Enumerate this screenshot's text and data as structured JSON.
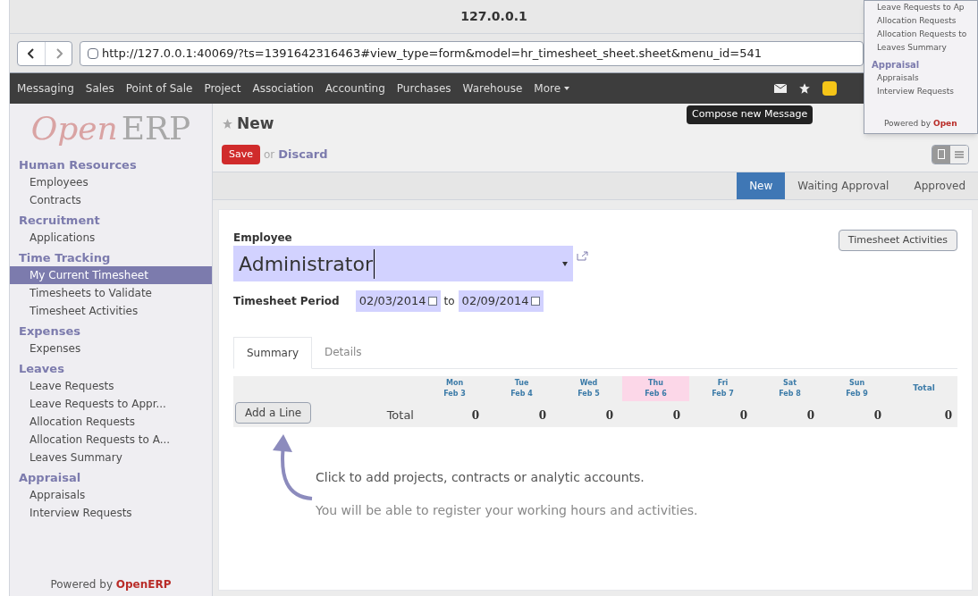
{
  "window": {
    "title": "127.0.0.1"
  },
  "address_bar": {
    "url": "http://127.0.0.1:40069/?ts=1391642316463#view_type=form&model=hr_timesheet_sheet.sheet&menu_id=541"
  },
  "top_menu": [
    "Messaging",
    "Sales",
    "Point of Sale",
    "Project",
    "Association",
    "Accounting",
    "Purchases",
    "Warehouse",
    "More"
  ],
  "tooltip": "Compose new Message",
  "inset": {
    "items": [
      {
        "label": "Leave Requests to Ap",
        "kind": "item"
      },
      {
        "label": "Allocation Requests",
        "kind": "item"
      },
      {
        "label": "Allocation Requests to",
        "kind": "item"
      },
      {
        "label": "Leaves Summary",
        "kind": "item"
      },
      {
        "label": "Appraisal",
        "kind": "heading"
      },
      {
        "label": "Appraisals",
        "kind": "item"
      },
      {
        "label": "Interview Requests",
        "kind": "item"
      }
    ],
    "footer": "Powered by",
    "footer_brand": "Open"
  },
  "sidebar": {
    "logo_open": "Open",
    "logo_erp": "ERP",
    "sections": [
      {
        "title": "Human Resources",
        "items": [
          {
            "label": "Employees",
            "selected": false
          },
          {
            "label": "Contracts",
            "selected": false
          }
        ]
      },
      {
        "title": "Recruitment",
        "items": [
          {
            "label": "Applications",
            "selected": false
          }
        ]
      },
      {
        "title": "Time Tracking",
        "items": [
          {
            "label": "My Current Timesheet",
            "selected": true
          },
          {
            "label": "Timesheets to Validate",
            "selected": false
          },
          {
            "label": "Timesheet Activities",
            "selected": false
          }
        ]
      },
      {
        "title": "Expenses",
        "items": [
          {
            "label": "Expenses",
            "selected": false
          }
        ]
      },
      {
        "title": "Leaves",
        "items": [
          {
            "label": "Leave Requests",
            "selected": false
          },
          {
            "label": "Leave Requests to Appr...",
            "selected": false
          },
          {
            "label": "Allocation Requests",
            "selected": false
          },
          {
            "label": "Allocation Requests to A...",
            "selected": false
          },
          {
            "label": "Leaves Summary",
            "selected": false
          }
        ]
      },
      {
        "title": "Appraisal",
        "items": [
          {
            "label": "Appraisals",
            "selected": false
          },
          {
            "label": "Interview Requests",
            "selected": false
          }
        ]
      }
    ],
    "footer": "Powered by",
    "footer_brand": "OpenERP"
  },
  "form": {
    "title": "New",
    "save": "Save",
    "or": "or",
    "discard": "Discard",
    "stages": [
      {
        "label": "New",
        "selected": true
      },
      {
        "label": "Waiting Approval",
        "selected": false
      },
      {
        "label": "Approved",
        "selected": false
      }
    ],
    "employee_label": "Employee",
    "employee_value": "Administrator",
    "activities_button": "Timesheet Activities",
    "period_label": "Timesheet Period",
    "date_from": "02/03/2014",
    "to": "to",
    "date_to": "02/09/2014",
    "tabs": [
      {
        "label": "Summary",
        "selected": true
      },
      {
        "label": "Details",
        "selected": false
      }
    ],
    "table": {
      "days": [
        {
          "day": "Mon",
          "date": "Feb 3",
          "today": false,
          "value": "0"
        },
        {
          "day": "Tue",
          "date": "Feb 4",
          "today": false,
          "value": "0"
        },
        {
          "day": "Wed",
          "date": "Feb 5",
          "today": false,
          "value": "0"
        },
        {
          "day": "Thu",
          "date": "Feb 6",
          "today": true,
          "value": "0"
        },
        {
          "day": "Fri",
          "date": "Feb 7",
          "today": false,
          "value": "0"
        },
        {
          "day": "Sat",
          "date": "Feb 8",
          "today": false,
          "value": "0"
        },
        {
          "day": "Sun",
          "date": "Feb 9",
          "today": false,
          "value": "0"
        }
      ],
      "total_header": "Total",
      "add_line": "Add a Line",
      "row_label": "Total",
      "grand_total": "0"
    },
    "hint": "Click to add projects, contracts or analytic accounts.",
    "hint2": "You will be able to register your working hours and activities."
  }
}
